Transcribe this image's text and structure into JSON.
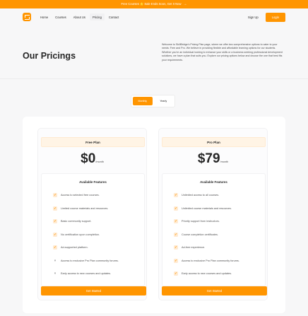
{
  "banner": {
    "text": "Free Courses 🌟 Sale Ends Soon, Get It Now",
    "arrow": "→"
  },
  "nav": {
    "items": [
      {
        "label": "Home",
        "active": false
      },
      {
        "label": "Courses",
        "active": false
      },
      {
        "label": "About Us",
        "active": false
      },
      {
        "label": "Pricing",
        "active": true
      },
      {
        "label": "Contact",
        "active": false
      }
    ],
    "signup": "Sign Up",
    "login": "Login"
  },
  "hero": {
    "title": "Our Pricings",
    "description": "Welcome to SkillBridge's Pricing Plan page, where we offer two comprehensive options to cater to your needs: Free and Pro. We believe in providing flexible and affordable learning options for our students. Whether you're an individual looking to enhance your skills or a business seeking professional development solutions, we have a plan that suits you. Explore our pricing options below and choose the one that best fits your requirements."
  },
  "billing_toggle": {
    "monthly": "Monthly",
    "yearly": "Yearly",
    "selected": "Monthly"
  },
  "colors": {
    "accent": "#ff9500",
    "accent_light": "#ffead1",
    "text": "#262626",
    "muted": "#4c4c4d"
  },
  "plans": [
    {
      "name": "Free Plan",
      "price": "$0",
      "period": "/month",
      "features_heading": "Available Features",
      "features": [
        {
          "text": "Access to selected free courses.",
          "included": true
        },
        {
          "text": "Limited course materials and resources.",
          "included": true
        },
        {
          "text": "Basic community support.",
          "included": true
        },
        {
          "text": "No certification upon completion.",
          "included": true
        },
        {
          "text": "Ad-supported platform.",
          "included": true
        },
        {
          "text": "Access to exclusive Pro Plan community forums.",
          "included": false
        },
        {
          "text": "Early access to new courses and updates.",
          "included": false
        }
      ],
      "cta": "Get Started"
    },
    {
      "name": "Pro Plan",
      "price": "$79",
      "period": "/month",
      "features_heading": "Available Features",
      "features": [
        {
          "text": "Unlimited access to all courses.",
          "included": true
        },
        {
          "text": "Unlimited course materials and resources.",
          "included": true
        },
        {
          "text": "Priority support from instructors.",
          "included": true
        },
        {
          "text": "Course completion certificates.",
          "included": true
        },
        {
          "text": "Ad-free experience.",
          "included": true
        },
        {
          "text": "Access to exclusive Pro Plan community forums.",
          "included": true
        },
        {
          "text": "Early access to new courses and updates.",
          "included": true
        }
      ],
      "cta": "Get Started"
    }
  ]
}
